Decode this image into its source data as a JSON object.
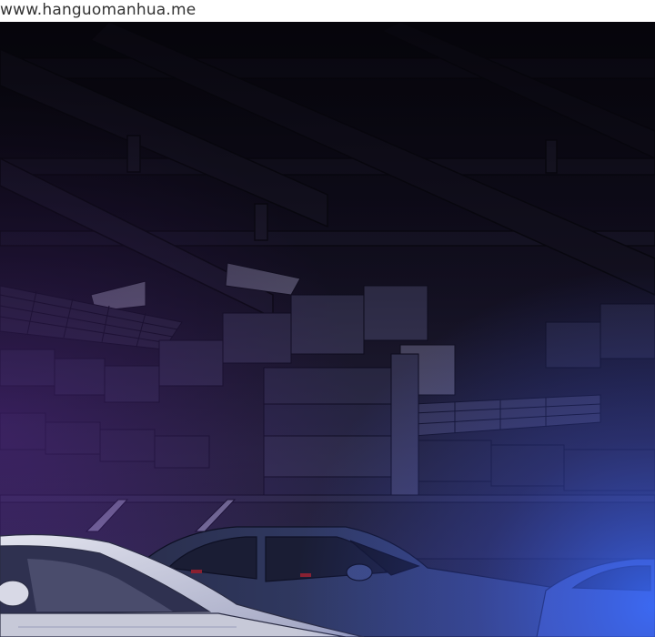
{
  "watermark": {
    "text": "www.hanguomanhua.me"
  },
  "colors": {
    "sky_dark": "#0e0c1c",
    "ceiling": "#1c1830",
    "duct": "#2b2742",
    "wall": "#3d3a5c",
    "pillar": "#4a4a6c",
    "lightbox": "#a7a3c7",
    "car_white": "#d6d8e4",
    "car_dark": "#2b3150",
    "glow_blue": "#3a6cff",
    "glow_purple": "#6a2fb0"
  }
}
